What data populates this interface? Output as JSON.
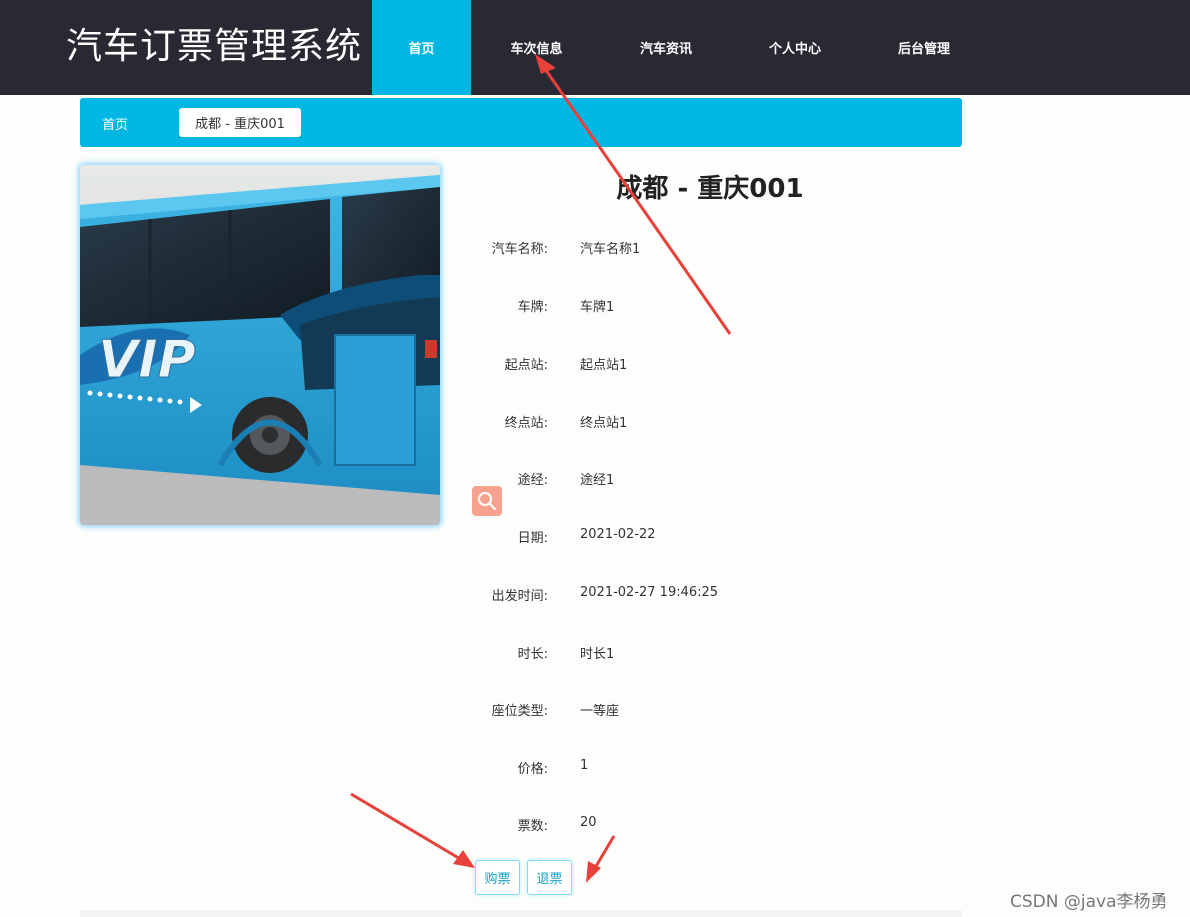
{
  "header": {
    "brand": "汽车订票管理系统",
    "nav": [
      {
        "label": "首页",
        "active": true
      },
      {
        "label": "车次信息",
        "active": false
      },
      {
        "label": "汽车资讯",
        "active": false
      },
      {
        "label": "个人中心",
        "active": false
      },
      {
        "label": "后台管理",
        "active": false
      }
    ]
  },
  "breadcrumb": {
    "home": "首页",
    "separator": "/",
    "current": "成都 - 重庆001"
  },
  "detail": {
    "title": "成都 - 重庆001",
    "fields": [
      {
        "label": "汽车名称:",
        "value": "汽车名称1"
      },
      {
        "label": "车牌:",
        "value": "车牌1"
      },
      {
        "label": "起点站:",
        "value": "起点站1"
      },
      {
        "label": "终点站:",
        "value": "终点站1"
      },
      {
        "label": "途经:",
        "value": "途经1"
      },
      {
        "label": "日期:",
        "value": "2021-02-22"
      },
      {
        "label": "出发时间:",
        "value": "2021-02-27 19:46:25"
      },
      {
        "label": "时长:",
        "value": "时长1"
      },
      {
        "label": "座位类型:",
        "value": "一等座"
      },
      {
        "label": "价格:",
        "value": "1"
      },
      {
        "label": "票数:",
        "value": "20"
      }
    ],
    "image_text": "VIP",
    "zoom_icon": "magnifier-icon"
  },
  "actions": {
    "buy": "购票",
    "refund": "退票"
  },
  "watermark": "CSDN @java李杨勇",
  "colors": {
    "nav_bg": "#282933",
    "accent": "#00b7e3",
    "zoom_bg": "#f7a28e",
    "arrow": "#e8403a"
  }
}
